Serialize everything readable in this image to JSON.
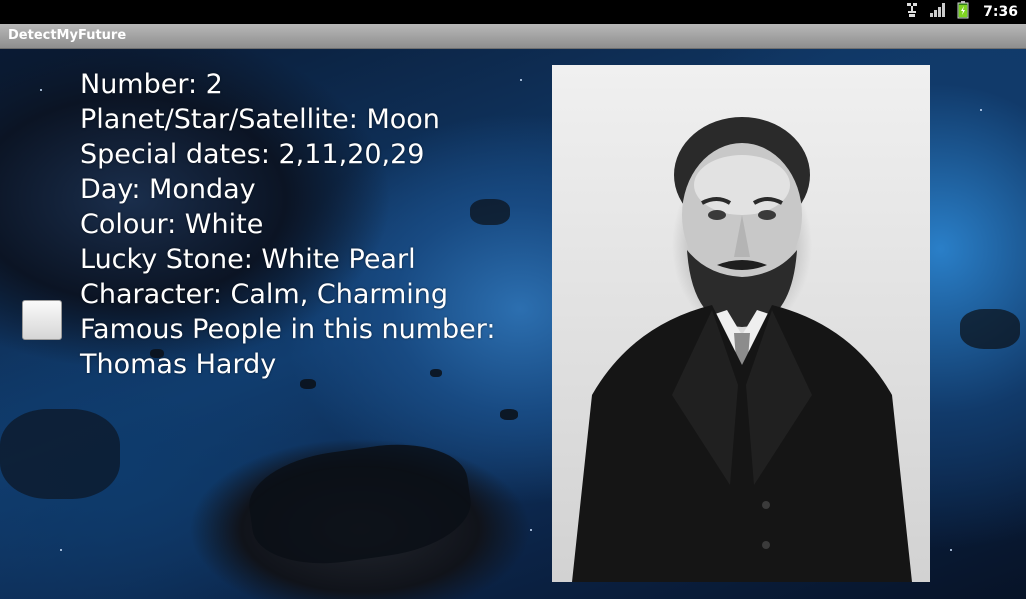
{
  "status_bar": {
    "time": "7:36",
    "icons": [
      "usb-debugging-icon",
      "signal-icon",
      "battery-icon"
    ]
  },
  "app": {
    "title": "DetectMyFuture"
  },
  "checkbox": {
    "checked": false
  },
  "info": {
    "lines": [
      "Number: 2",
      "Planet/Star/Satellite: Moon",
      "Special dates: 2,11,20,29",
      "Day: Monday",
      "Colour: White",
      "Lucky Stone: White Pearl",
      "Character: Calm, Charming",
      "Famous People in this number:",
      "Thomas Hardy"
    ]
  },
  "colors": {
    "text": "#ffffff",
    "status_bar": "#000000",
    "title_bar": "#a3a3a3",
    "background_accent": "#2a7fc8"
  }
}
